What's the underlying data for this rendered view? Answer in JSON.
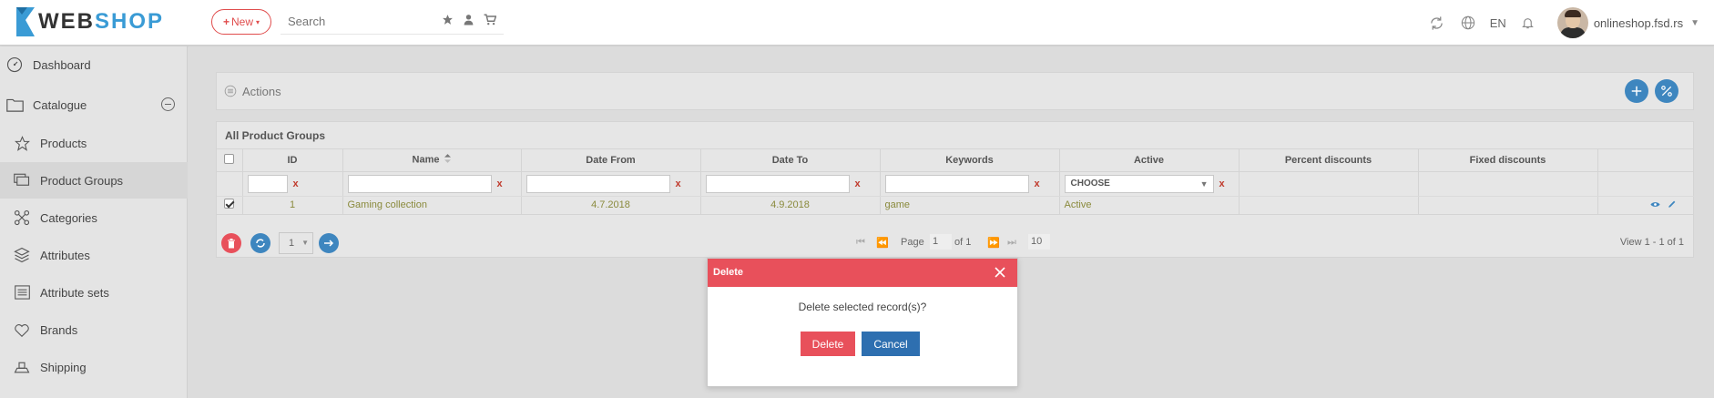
{
  "brand": {
    "name_a": "WEB",
    "name_b": "SHOP"
  },
  "header": {
    "new_label": "New",
    "search_placeholder": "Search",
    "language": "EN",
    "username": "onlineshop.fsd.rs"
  },
  "sidebar": {
    "items": [
      {
        "label": "Dashboard",
        "icon": "dashboard-icon"
      },
      {
        "label": "Catalogue",
        "icon": "folder-icon"
      },
      {
        "label": "Products",
        "icon": "star-icon"
      },
      {
        "label": "Product Groups",
        "icon": "product-groups-icon"
      },
      {
        "label": "Categories",
        "icon": "categories-icon"
      },
      {
        "label": "Attributes",
        "icon": "layers-icon"
      },
      {
        "label": "Attribute sets",
        "icon": "list-icon"
      },
      {
        "label": "Brands",
        "icon": "heart-icon"
      },
      {
        "label": "Shipping",
        "icon": "shipping-icon"
      }
    ]
  },
  "actions": {
    "label": "Actions"
  },
  "grid": {
    "title": "All Product Groups",
    "columns": [
      "ID",
      "Name",
      "Date From",
      "Date To",
      "Keywords",
      "Active",
      "Percent discounts",
      "Fixed discounts"
    ],
    "filter_x": "x",
    "active_filter": "CHOOSE",
    "rows": [
      {
        "id": "1",
        "name": "Gaming collection",
        "date_from": "4.7.2018",
        "date_to": "4.9.2018",
        "keywords": "game",
        "active": "Active"
      }
    ],
    "pager": {
      "page_size": "1",
      "page_label": "Page",
      "page_value": "1",
      "of_label": "of 1",
      "rows_per_page": "10",
      "view_text": "View 1 - 1 of 1"
    }
  },
  "dialog": {
    "title": "Delete",
    "message": "Delete selected record(s)?",
    "delete_label": "Delete",
    "cancel_label": "Cancel"
  },
  "colors": {
    "accent": "#3e86bf",
    "danger": "#e8505b",
    "brand_blue": "#3a9bd5"
  }
}
